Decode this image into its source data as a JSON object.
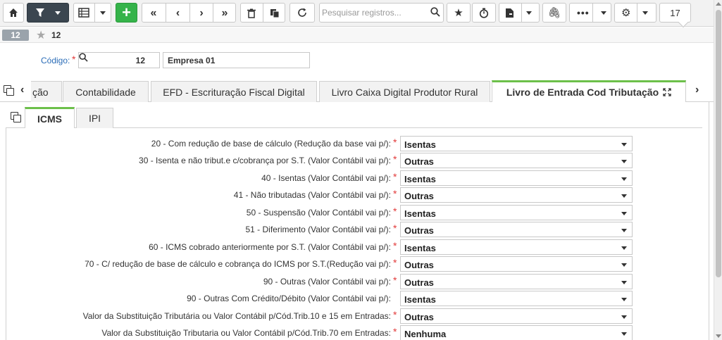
{
  "toolbar": {
    "search_placeholder": "Pesquisar registros...",
    "record_counter": "17"
  },
  "record": {
    "badge": "12",
    "number": "12"
  },
  "codigo": {
    "label": "Código:",
    "value": "12",
    "name": "Empresa 01"
  },
  "main_tabs": [
    {
      "label": "ção"
    },
    {
      "label": "Contabilidade"
    },
    {
      "label": "EFD - Escrituração Fiscal Digital"
    },
    {
      "label": "Livro Caixa Digital Produtor Rural"
    },
    {
      "label": "Livro de Entrada Cod Tributação"
    }
  ],
  "sub_tabs": [
    {
      "label": "ICMS"
    },
    {
      "label": "IPI"
    }
  ],
  "fields": [
    {
      "label": "20 - Com redução de base de cálculo (Redução da base vai p/):",
      "value": "Isentas",
      "required": true
    },
    {
      "label": "30 - Isenta e não tribut.e c/cobrança por S.T. (Valor Contábil vai p/):",
      "value": "Outras",
      "required": true
    },
    {
      "label": "40 - Isentas (Valor Contábil vai p/):",
      "value": "Isentas",
      "required": true
    },
    {
      "label": "41 - Não tributadas (Valor Contábil vai p/):",
      "value": "Outras",
      "required": true
    },
    {
      "label": "50 - Suspensão (Valor Contábil vai p/):",
      "value": "Isentas",
      "required": true
    },
    {
      "label": "51 - Diferimento (Valor Contábil vai p/):",
      "value": "Outras",
      "required": true
    },
    {
      "label": "60 - ICMS cobrado anteriormente por S.T. (Valor Contábil vai p/):",
      "value": "Isentas",
      "required": true
    },
    {
      "label": "70 - C/ redução de base de cálculo e cobrança do ICMS por S.T.(Redução vai p/):",
      "value": "Outras",
      "required": true
    },
    {
      "label": "90 - Outras (Valor Contábil vai p/):",
      "value": "Outras",
      "required": true
    },
    {
      "label": "90 - Outras Com Crédito/Débito (Valor Contábil vai p/):",
      "value": "Isentas",
      "required": false
    },
    {
      "label": "Valor da Substituição Tributária ou Valor Contábil p/Cód.Trib.10 e 15 em Entradas:",
      "value": "Outras",
      "required": true
    },
    {
      "label": "Valor da Substituição Tributaria ou Valor Contábil p/Cód.Trib.70 em Entradas:",
      "value": "Nenhuma",
      "required": true
    }
  ]
}
